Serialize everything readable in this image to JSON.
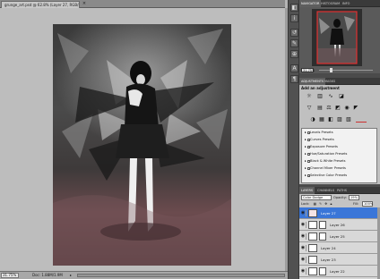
{
  "document": {
    "tab_title": "grunge_art.psd @ 62.8% (Layer 27, RGB/8)",
    "close_glyph": "×",
    "zoom": "31.75%",
    "doc_info": "Doc: 1.88M/1.9M",
    "status_arrow": "▸"
  },
  "icon_strip": {
    "icons": [
      {
        "name": "navigator-icon",
        "glyph": "◧"
      },
      {
        "name": "info-icon",
        "glyph": "i"
      },
      {
        "name": "history-icon",
        "glyph": "↺"
      },
      {
        "name": "brush-icon",
        "glyph": "✎"
      },
      {
        "name": "clone-icon",
        "glyph": "⊕"
      },
      {
        "name": "character-icon",
        "glyph": "A"
      },
      {
        "name": "paragraph-icon",
        "glyph": "¶"
      }
    ]
  },
  "navigator": {
    "tabs": [
      "NAVIGATOR",
      "HISTOGRAM",
      "INFO"
    ],
    "zoom": "31.75%"
  },
  "adjustments": {
    "tabs": [
      "ADJUSTMENTS",
      "MASKS"
    ],
    "title": "Add an adjustment",
    "presets": [
      "Levels Presets",
      "Curves Presets",
      "Exposure Presets",
      "Hue/Saturation Presets",
      "Black & White Presets",
      "Channel Mixer Presets",
      "Selective Color Presets"
    ]
  },
  "layers": {
    "tabs": [
      "LAYERS",
      "CHANNELS",
      "PATHS"
    ],
    "blend_mode": "Color Dodge",
    "opacity_label": "Opacity:",
    "opacity": "19%",
    "lock_label": "Lock:",
    "fill_label": "Fill:",
    "fill": "100%",
    "items": [
      {
        "name": "Layer 27",
        "selected": true
      },
      {
        "name": "Layer 26",
        "selected": false
      },
      {
        "name": "Layer 25",
        "selected": false
      },
      {
        "name": "Layer 24",
        "selected": false
      },
      {
        "name": "Layer 23",
        "selected": false
      },
      {
        "name": "Layer 22",
        "selected": false
      }
    ]
  },
  "colors": {
    "selected_layer": "#3a76d8",
    "panel_dark": "#4b4b4b",
    "navigator_frame": "#e03030"
  }
}
